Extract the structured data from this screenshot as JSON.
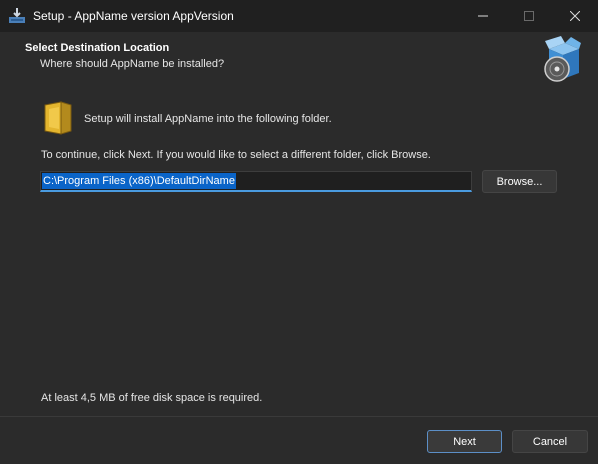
{
  "window": {
    "title": "Setup - AppName version AppVersion"
  },
  "header": {
    "heading": "Select Destination Location",
    "subheading": "Where should AppName be installed?"
  },
  "main": {
    "intro_text": "Setup will install AppName into the following folder.",
    "continue_text": "To continue, click Next. If you would like to select a different folder, click Browse.",
    "directory_value": "C:\\Program Files (x86)\\DefaultDirName",
    "browse_label": "Browse...",
    "disk_space_text": "At least 4,5 MB of free disk space is required."
  },
  "footer": {
    "next_label": "Next",
    "cancel_label": "Cancel"
  },
  "colors": {
    "accent": "#0a64c8",
    "focus_border": "#4a9be0",
    "background": "#2b2b2b",
    "titlebar": "#202020"
  },
  "icons": [
    "setup-app-icon",
    "minimize-icon",
    "maximize-icon",
    "close-icon",
    "install-box-icon",
    "folder-icon"
  ]
}
